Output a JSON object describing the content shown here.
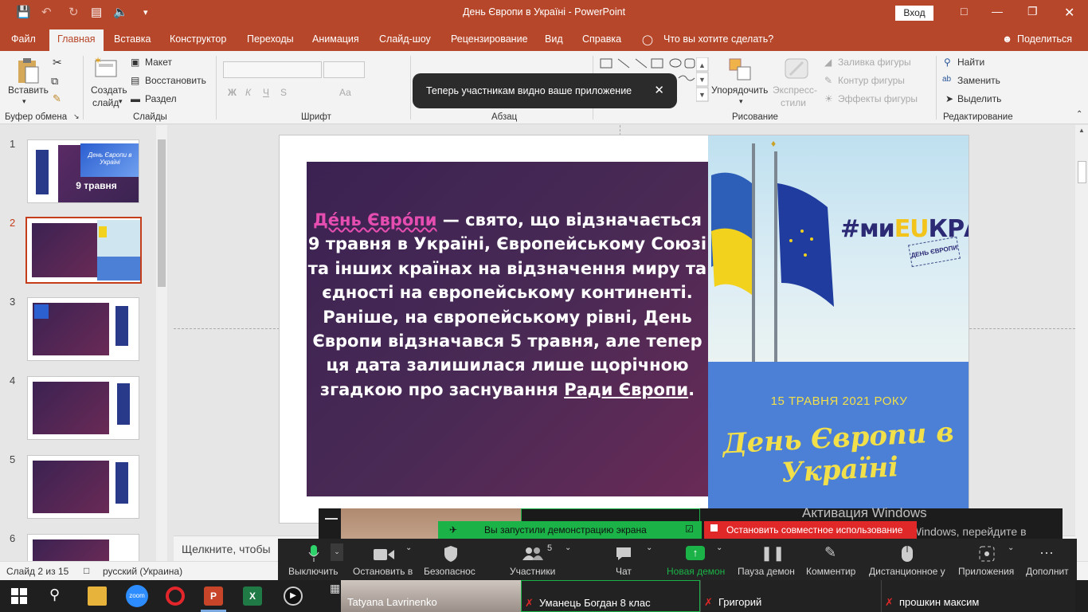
{
  "window": {
    "title": "День Європи в Україні  -  PowerPoint",
    "login_button": "Вход"
  },
  "tabs": [
    "Файл",
    "Главная",
    "Вставка",
    "Конструктор",
    "Переходы",
    "Анимация",
    "Слайд-шоу",
    "Рецензирование",
    "Вид",
    "Справка"
  ],
  "tell_me": "Что вы хотите сделать?",
  "share": "Поделиться",
  "ribbon": {
    "paste": "Вставить",
    "clipboard": "Буфер обмена",
    "new_slide_1": "Создать",
    "new_slide_2": "слайд",
    "layout": "Макет",
    "reset": "Восстановить",
    "section": "Раздел",
    "slides": "Слайды",
    "font_group": "Шрифт",
    "bold": "Ж",
    "italic": "К",
    "underline": "Ч",
    "strike": "S",
    "aa": "Аа",
    "paragraph": "Абзац",
    "arrange_1": "Упорядочить",
    "express_1": "Экспресс-",
    "express_2": "стили",
    "fill": "Заливка фигуры",
    "outline": "Контур фигуры",
    "effects": "Эффекты фигуры",
    "drawing": "Рисование",
    "find": "Найти",
    "replace": "Заменить",
    "select": "Выделить",
    "editing": "Редактирование"
  },
  "toast": "Теперь участникам видно ваше приложение",
  "thumbnails": {
    "numbers": [
      "1",
      "2",
      "3",
      "4",
      "5",
      "6"
    ],
    "t1_title": "День Європи в Україні",
    "t1_date": "9 травня"
  },
  "slide": {
    "pink": "Де́нь Євро́пи",
    "line1": " — свято, що відзначається",
    "line2": "9 травня в Україні, Європейському Союзі та інших країнах на відзначення миру та єдності на європейському континенті. Раніше, на європейському рівні, День Європи відзначався 5 травня, але тепер ця дата залишилася лише щорічною згадкою про заснування ",
    "underlined": "Ради Європи",
    "end": ".",
    "hashtag_a": "#ми",
    "hashtag_b": "EU",
    "hashtag_c": "КРАЇНА",
    "stamp": "ДЕНЬ ЄВРОПИ",
    "banner_date": "15 ТРАВНЯ 2021 РОКУ",
    "banner_title": "День Європи в Україні"
  },
  "notes_hint": "Щелкните, чтобы",
  "status": {
    "slide": "Слайд 2 из 15",
    "language": "русский (Украина)"
  },
  "zoom": {
    "share_started": "Вы запустили демонстрацию экрана",
    "stop_share": "Остановить совместное использование",
    "win_activation": "Активация Windows",
    "win_activation_2": "Чтобы активировать Windows, перейдите в раздел \"Параметры\".",
    "buttons": [
      "Выключить",
      "Остановить в",
      "Безопаснос",
      "Участники",
      "Чат",
      "Новая демон",
      "Пауза демон",
      "Комментир",
      "Дистанционное у",
      "Приложения",
      "Дополнит"
    ],
    "participant_count": "5",
    "participants": [
      "Tatyana Lavrinenko",
      "Уманець Богдан 8 клас",
      "Григорий",
      "прошкин максим"
    ]
  },
  "colors": {
    "accent": "#b7472a",
    "zoom_green": "#1bb247",
    "zoom_red": "#e02828"
  }
}
